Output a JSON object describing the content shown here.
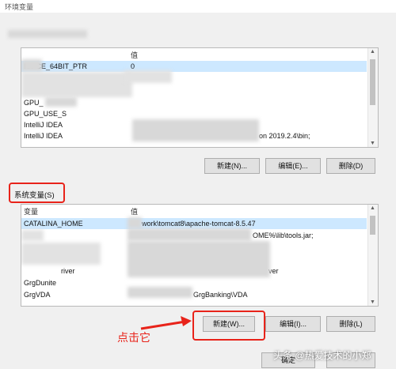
{
  "window": {
    "title": "环境变量"
  },
  "user_vars": {
    "col_value": "值",
    "rows": [
      {
        "name": "IOPCE_64BIT_PTR",
        "value": "0"
      },
      {
        "name": "GPU_",
        "value": ""
      },
      {
        "name": "GPU_USE_S",
        "value": ""
      },
      {
        "name": "IntelliJ IDEA",
        "value": ""
      },
      {
        "name": "IntelliJ IDEA",
        "value": "on 2019.2.4\\bin;"
      }
    ],
    "buttons": {
      "new": "新建(N)...",
      "edit": "编辑(E)...",
      "delete": "删除(D)"
    }
  },
  "system_vars": {
    "label": "系统变量(S)",
    "col_var": "变量",
    "col_value": "值",
    "rows": [
      {
        "name": "CATALINA_HOME",
        "value": "work\\tomcat8\\apache-tomcat-8.5.47"
      },
      {
        "name": "",
        "value": "OME%\\lib\\tools.jar;"
      },
      {
        "name": "",
        "value": ""
      },
      {
        "name": "river",
        "value": "ver"
      },
      {
        "name": "GrgDunite",
        "value": ""
      },
      {
        "name": "GrgVDA",
        "value": "GrgBanking\\VDA"
      }
    ],
    "buttons": {
      "new": "新建(W)...",
      "edit": "编辑(I)...",
      "delete": "删除(L)"
    }
  },
  "annotation": {
    "text": "点击它"
  },
  "footer": {
    "ok": "确定"
  },
  "watermark": "头条 @热爱技术的小郑",
  "colors": {
    "highlight": "#e8231a",
    "selection": "#cde8ff"
  }
}
